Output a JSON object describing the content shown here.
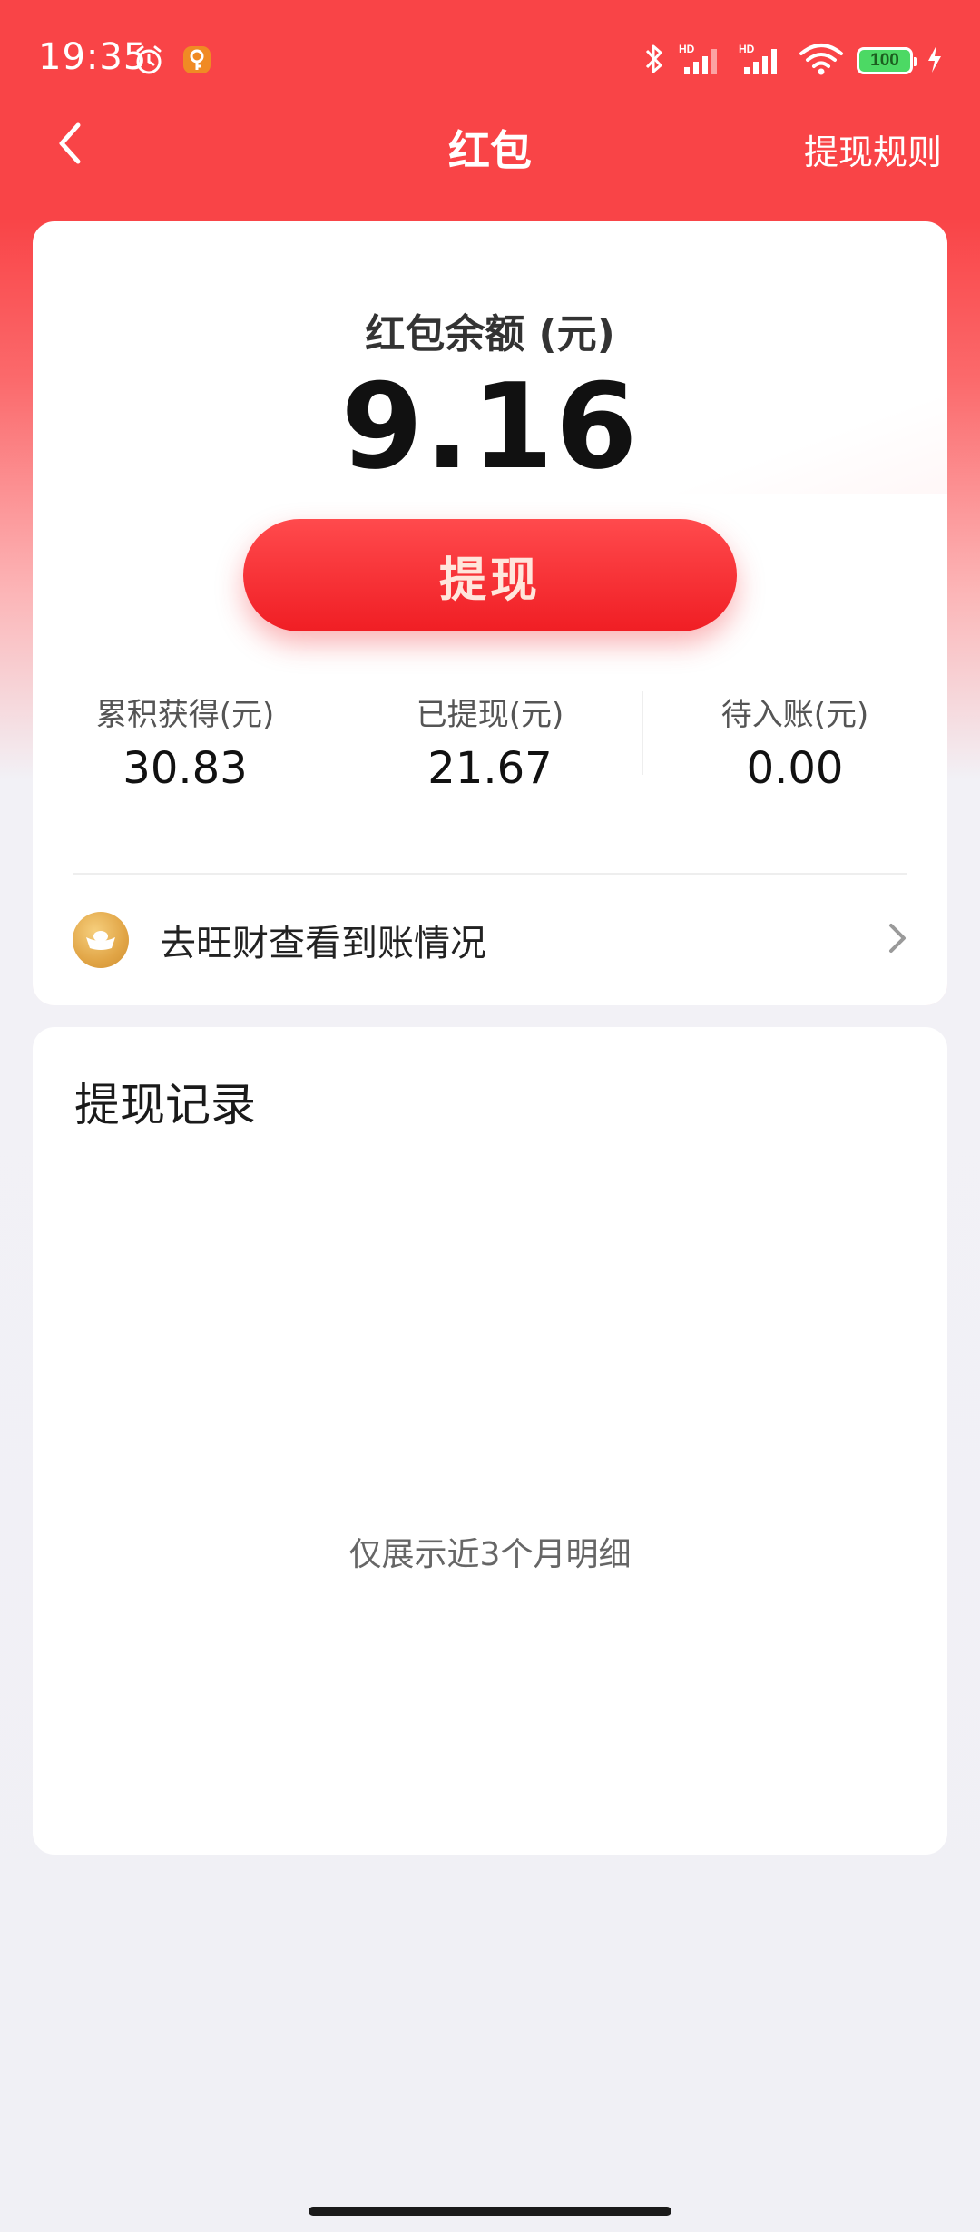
{
  "status_bar": {
    "time": "19:35",
    "battery_level": "100",
    "signal_tag_1": "HD",
    "signal_tag_2": "HD",
    "icons": [
      "alarm-icon",
      "app-notification-icon",
      "bluetooth-icon",
      "hd-signal-icon",
      "hd-signal-icon",
      "wifi-icon",
      "battery-icon",
      "charging-icon"
    ]
  },
  "nav": {
    "title": "红包",
    "rules_link": "提现规则",
    "back_icon": "chevron-left-icon"
  },
  "balance": {
    "label": "红包余额 (元)",
    "value": "9.16",
    "withdraw_button": "提现"
  },
  "stats": [
    {
      "label": "累积获得(元)",
      "value": "30.83"
    },
    {
      "label": "已提现(元)",
      "value": "21.67"
    },
    {
      "label": "待入账(元)",
      "value": "0.00"
    }
  ],
  "wangcai": {
    "text": "去旺财查看到账情况",
    "icon": "gold-ingot-icon"
  },
  "records": {
    "title": "提现记录",
    "empty_note": "仅展示近3个月明细"
  },
  "colors": {
    "brand_red": "#f94447",
    "button_red": "#f01e24",
    "page_bg": "#f0f0f5"
  }
}
